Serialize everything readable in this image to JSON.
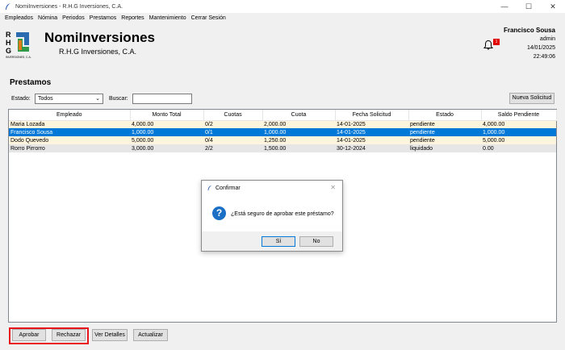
{
  "window": {
    "title": "NomiInversiones - R.H.G Inversiones, C.A.",
    "minimize": "—",
    "maximize": "☐",
    "close": "✕"
  },
  "menu": [
    "Empleados",
    "Nómina",
    "Periodos",
    "Prestamos",
    "Reportes",
    "Mantenimiento",
    "Cerrar Sesión"
  ],
  "header": {
    "brand_title": "NomiInversiones",
    "brand_subtitle": "R.H.G Inversiones, C.A.",
    "logo_letters": [
      "R",
      "H",
      "G"
    ],
    "logo_caption": "INVERSIONES, C.A.",
    "notification_count": "1",
    "user_name": "Francisco Sousa",
    "user_role": "admin",
    "date": "14/01/2025",
    "time": "22:49:06"
  },
  "section_title": "Prestamos",
  "filters": {
    "estado_label": "Estado:",
    "estado_value": "Todos",
    "buscar_label": "Buscar:",
    "buscar_value": "",
    "nueva_solicitud_label": "Nueva Solicitud"
  },
  "table": {
    "columns": [
      "Empleado",
      "Monto Total",
      "Cuotas",
      "Cuota",
      "Fecha Solicitud",
      "Estado",
      "Saldo Pendiente"
    ],
    "rows": [
      [
        "Maria Lozada",
        "4,000.00",
        "0/2",
        "2,000.00",
        "14-01-2025",
        "pendiente",
        "4,000.00"
      ],
      [
        "Francisco Sousa",
        "1,000.00",
        "0/1",
        "1,000.00",
        "14-01-2025",
        "pendiente",
        "1,000.00"
      ],
      [
        "Dodo Quevedo",
        "5,000.00",
        "0/4",
        "1,250.00",
        "14-01-2025",
        "pendiente",
        "5,000.00"
      ],
      [
        "Rorro Pirrorro",
        "3,000.00",
        "2/2",
        "1,500.00",
        "30-12-2024",
        "liquidado",
        "0.00"
      ]
    ],
    "selected_row": 1
  },
  "actions": {
    "aprobar": "Aprobar",
    "rechazar": "Rechazar",
    "ver_detalles": "Ver Detalles",
    "actualizar": "Actualizar"
  },
  "dialog": {
    "title": "Confirmar",
    "message": "¿Está seguro de aprobar este préstamo?",
    "yes": "Sí",
    "no": "No",
    "icon": "question-icon"
  },
  "colors": {
    "selected_row": "#0078d7",
    "pending_row": "#fdf4dd",
    "liquidated_row": "#e6e6e6",
    "highlight_border": "#e8141b",
    "badge": "#e00000"
  }
}
